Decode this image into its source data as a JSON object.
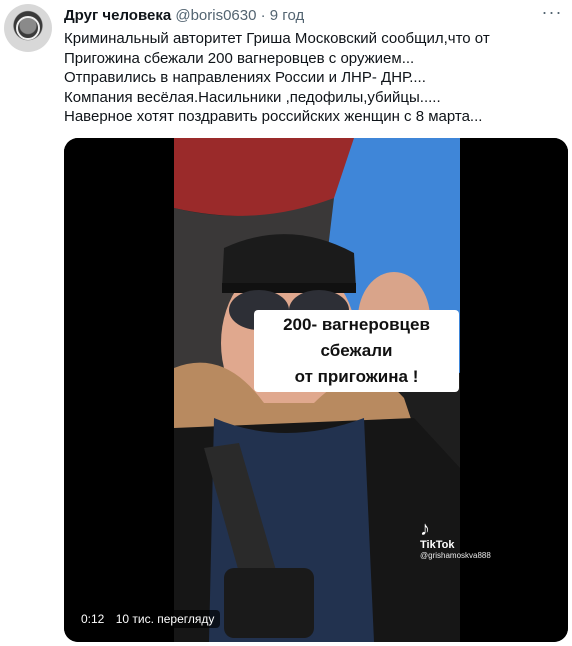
{
  "tweet": {
    "author_name": "Друг человека",
    "handle": "@boris0630",
    "separator": "·",
    "time": "9 год",
    "more_icon": "more-dots-icon",
    "lines": [
      "Криминальный авторитет Гриша Московский сообщил,что от",
      "Пригожина сбежали 200 вагнеровцев с оружием...",
      "Отправились в направлениях  России и ЛНР- ДНР....",
      "Компания весёлая.Насильники ,педофилы,убийцы.....",
      "Наверное хотят поздравить российских женщин с 8 марта..."
    ]
  },
  "video": {
    "caption_line1": "200- вагнеровцев сбежали",
    "caption_line2": "от пригожина !",
    "watermark_logo": "tiktok-icon",
    "watermark_brand": "TikTok",
    "watermark_user": "@grishamoskva888",
    "time": "0:12",
    "views": "10 тис. перегляду"
  }
}
